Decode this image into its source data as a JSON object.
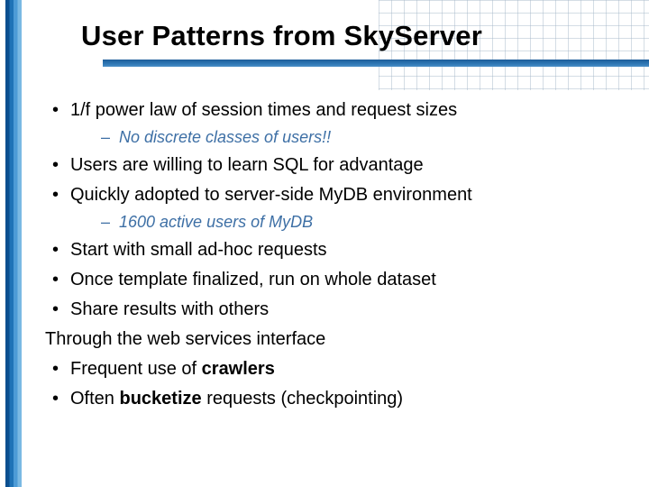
{
  "title": "User Patterns from SkyServer",
  "bullets": {
    "b1": "1/f power law of session times and request sizes",
    "b1_sub": "No discrete classes of users!!",
    "b2": "Users are willing to learn SQL for advantage",
    "b3": "Quickly adopted to server-side MyDB environment",
    "b3_sub": "1600 active users of MyDB",
    "b4": "Start with small ad-hoc requests",
    "b5": "Once template finalized, run on whole dataset",
    "b6": "Share results with others",
    "plain": "Through the web services interface",
    "b7_pre": "Frequent use of ",
    "b7_bold": "crawlers",
    "b8_pre": "Often ",
    "b8_bold": "bucketize",
    "b8_post": " requests (checkpointing)"
  }
}
